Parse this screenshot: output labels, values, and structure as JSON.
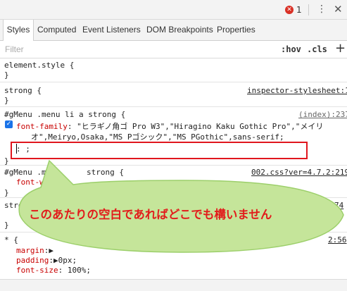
{
  "toolbar": {
    "error_icon": "error-icon",
    "error_count": "1",
    "menu_icon": "kebab-icon",
    "close_icon": "close-icon"
  },
  "tabs": [
    {
      "label": "Styles",
      "active": true
    },
    {
      "label": "Computed"
    },
    {
      "label": "Event Listeners"
    },
    {
      "label": "DOM Breakpoints"
    },
    {
      "label": "Properties"
    }
  ],
  "filter": {
    "placeholder": "Filter",
    "hov": ":hov",
    "cls": ".cls",
    "add": "+"
  },
  "rules": {
    "r1": {
      "selector": "element.style {",
      "close": "}"
    },
    "r2": {
      "selector": "strong {",
      "source": "inspector-stylesheet:1",
      "close": "}"
    },
    "r3": {
      "selector": "#gMenu .menu li a strong {",
      "source": "(index):237",
      "prop": "font-family",
      "value_line1": ": \"ヒラギノ角ゴ Pro W3\",\"Hiragino Kaku Gothic Pro\",\"メイリ",
      "value_line2": "オ\",Meiryo,Osaka,\"MS Pゴシック\",\"MS PGothic\",sans-serif;",
      "editing": ": ;",
      "close": "}"
    },
    "r4": {
      "selector_a": "#gMenu .me",
      "selector_b": "strong {",
      "source": "002.css?ver=4.7.2:219",
      "prop_partial": "font-weig",
      "close": "}"
    },
    "r5": {
      "selector_partial": "stro",
      "source_partial": "74",
      "close": "}"
    },
    "r6": {
      "selector": "* {",
      "source_partial": "2:56",
      "margin_prop": "margin",
      "margin_partial": ":▶",
      "padding_prop": "padding",
      "padding_val": ":▶0px;",
      "fontsize_prop": "font-size",
      "fontsize_val": ": 100%;"
    }
  },
  "annotation": {
    "text": "このあたりの空白であればどこでも構いません",
    "text_color": "#e21b1b",
    "bubble_color": "#c5e59a",
    "bubble_border": "#9ccf6a",
    "box_color": "#e0161e"
  }
}
